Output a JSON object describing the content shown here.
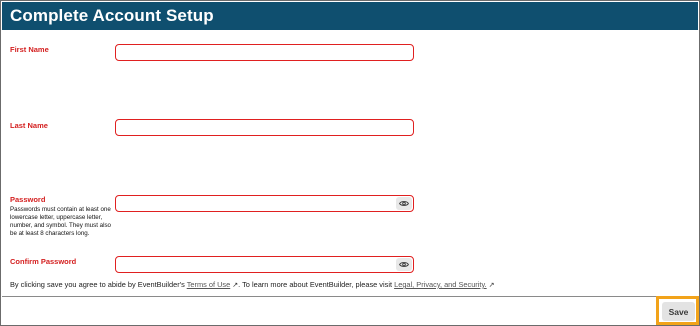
{
  "header": {
    "title": "Complete Account Setup"
  },
  "form": {
    "first_name": {
      "label": "First Name",
      "value": "",
      "placeholder": ""
    },
    "last_name": {
      "label": "Last Name",
      "value": "",
      "placeholder": ""
    },
    "password": {
      "label": "Password",
      "hint": "Passwords must contain at least one lowercase letter, uppercase letter, number, and symbol. They must also be at least 8 characters long.",
      "value": "",
      "placeholder": "",
      "toggle_icon": "eye-icon"
    },
    "confirm_password": {
      "label": "Confirm Password",
      "value": "",
      "placeholder": "",
      "toggle_icon": "eye-icon"
    }
  },
  "agreement": {
    "prefix": "By clicking save you agree to abide by EventBuilder's",
    "terms_link": "Terms of Use",
    "middle": ". To learn more about EventBuilder, please visit",
    "privacy_link": "Legal, Privacy, and Security.",
    "external_icon": "external-link-icon"
  },
  "footer": {
    "save_label": "Save"
  },
  "colors": {
    "header_bg": "#0f4f6f",
    "error_red": "#e02020",
    "highlight": "#f2a31a"
  }
}
